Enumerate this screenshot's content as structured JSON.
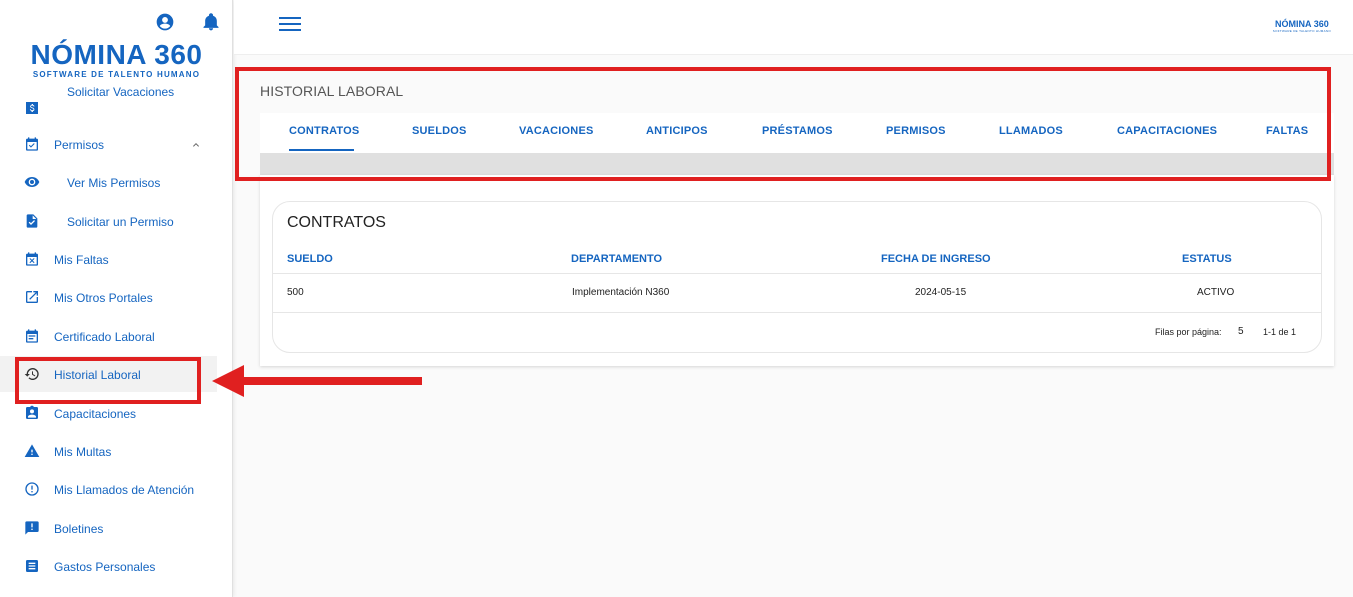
{
  "brand": {
    "logo_text": "NÓMINA 360",
    "logo_subtitle": "SOFTWARE DE TALENTO HUMANO",
    "mini_logo_text": "NÓMINA 360",
    "mini_logo_subtitle": "SOFTWARE DE TALENTO HUMANO",
    "accent_color": "#1565c0",
    "highlight_color": "#e02020"
  },
  "header_icons": [
    "account-circle-icon",
    "bell-icon"
  ],
  "sidebar": {
    "items": [
      {
        "label": "Solicitar Vacaciones",
        "icon": "money-icon",
        "sub": true
      },
      {
        "label": "Permisos",
        "icon": "calendar-check-icon",
        "expanded": true
      },
      {
        "label": "Ver Mis Permisos",
        "icon": "eye-icon",
        "sub": true
      },
      {
        "label": "Solicitar un Permiso",
        "icon": "file-check-icon",
        "sub": true
      },
      {
        "label": "Mis Faltas",
        "icon": "calendar-x-icon"
      },
      {
        "label": "Mis Otros Portales",
        "icon": "external-link-icon"
      },
      {
        "label": "Certificado Laboral",
        "icon": "calendar-icon"
      },
      {
        "label": "Historial Laboral",
        "icon": "history-icon",
        "active": true
      },
      {
        "label": "Capacitaciones",
        "icon": "badge-icon"
      },
      {
        "label": "Mis Multas",
        "icon": "warning-icon"
      },
      {
        "label": "Mis Llamados de Atención",
        "icon": "alert-circle-icon"
      },
      {
        "label": "Boletines",
        "icon": "announcement-icon"
      },
      {
        "label": "Gastos Personales",
        "icon": "list-icon"
      }
    ]
  },
  "page": {
    "title": "HISTORIAL LABORAL",
    "tabs": [
      "CONTRATOS",
      "SUELDOS",
      "VACACIONES",
      "ANTICIPOS",
      "PRÉSTAMOS",
      "PERMISOS",
      "LLAMADOS",
      "CAPACITACIONES",
      "FALTAS"
    ],
    "active_tab": "CONTRATOS"
  },
  "contracts": {
    "title": "CONTRATOS",
    "columns": [
      "SUELDO",
      "DEPARTAMENTO",
      "FECHA DE INGRESO",
      "ESTATUS"
    ],
    "rows": [
      [
        "500",
        "Implementación N360",
        "2024-05-15",
        "ACTIVO"
      ]
    ],
    "rows_per_page_label": "Filas por página:",
    "rows_per_page": "5",
    "range": "1-1 de 1"
  }
}
